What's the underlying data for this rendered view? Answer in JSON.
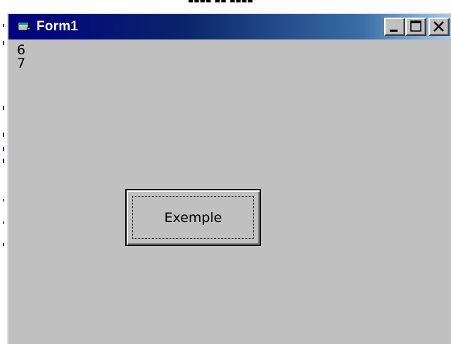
{
  "window": {
    "title": "Form1",
    "icon": "form-icon",
    "buttons": [
      {
        "name": "minimize",
        "icon": "minimize-icon"
      },
      {
        "name": "maximize",
        "icon": "maximize-icon"
      },
      {
        "name": "close",
        "icon": "close-icon"
      }
    ]
  },
  "client": {
    "printed_lines": [
      "6",
      "7"
    ],
    "example_button_label": "Exemple"
  },
  "colors": {
    "titlebar_start": "#000080",
    "titlebar_end": "#a6caf0",
    "face": "#c0c0c0"
  }
}
